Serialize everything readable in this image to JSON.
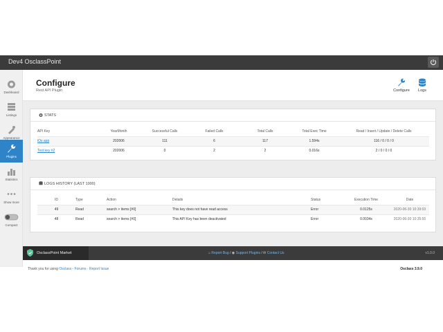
{
  "topbar": {
    "title": "Dev4 OsclassPoint"
  },
  "sidebar": {
    "items": [
      {
        "label": "Dashboard",
        "icon": "dashboard-icon"
      },
      {
        "label": "Listings",
        "icon": "listings-icon"
      },
      {
        "label": "Appearance",
        "icon": "appearance-icon"
      },
      {
        "label": "Plugins",
        "icon": "plugins-icon",
        "active": true
      },
      {
        "label": "Statistics",
        "icon": "statistics-icon"
      },
      {
        "label": "Show more",
        "icon": "more-icon"
      },
      {
        "label": "Compact",
        "icon": "toggle-icon"
      }
    ]
  },
  "page": {
    "title": "Configure",
    "subtitle": "Rest API Plugin",
    "buttons": {
      "configure": "Configure",
      "logs": "Logs"
    }
  },
  "stats": {
    "heading": "STATS",
    "columns": [
      "API Key",
      "YearMonth",
      "Successful Calls",
      "Failed Calls",
      "Total Calls",
      "Total Exec Time",
      "Read / Insert / Update / Delete Calls"
    ],
    "rows": [
      [
        "iOs app",
        "202006",
        "111",
        "6",
        "117",
        "1.594s",
        "116 / 0 / 0 / 0"
      ],
      [
        "Test key #2",
        "202006",
        "0",
        "2",
        "2",
        "0.016s",
        "2 / 0 / 0 / 0"
      ]
    ]
  },
  "logs": {
    "heading": "LOGS HISTORY (LAST 1000)",
    "columns": [
      "ID",
      "Type",
      "Action",
      "Details",
      "Status",
      "Execution Time",
      "Date"
    ],
    "rows": [
      [
        "49",
        "Read",
        "search > items [#0]",
        "This key does not have read access",
        "Error",
        "0.0125s",
        "2020-06-30 10:39:03"
      ],
      [
        "48",
        "Read",
        "search > items [#0]",
        "This API Key has been deactivated",
        "Error",
        "0.0034s",
        "2020-06-30 10:35:55"
      ]
    ]
  },
  "footer": {
    "market": "OsclassPoint Market",
    "report_bug": "Report Bug",
    "sep1": " / ",
    "support_plugins": "Support Plugins",
    "sep2": " / ",
    "contact_us": "Contact Us",
    "version": "v1.0.0"
  },
  "bottom": {
    "thanks": "Thank you for using ",
    "osclass": "Osclass",
    "dash1": " - ",
    "forums": "Forums",
    "dash2": " · ",
    "report_issue": "Report Issue",
    "osclass_version": "Osclass 3.9.0"
  },
  "colors": {
    "accent": "#2f84c7",
    "topbar": "#3b3b3b",
    "footer": "#3b3b3b"
  }
}
